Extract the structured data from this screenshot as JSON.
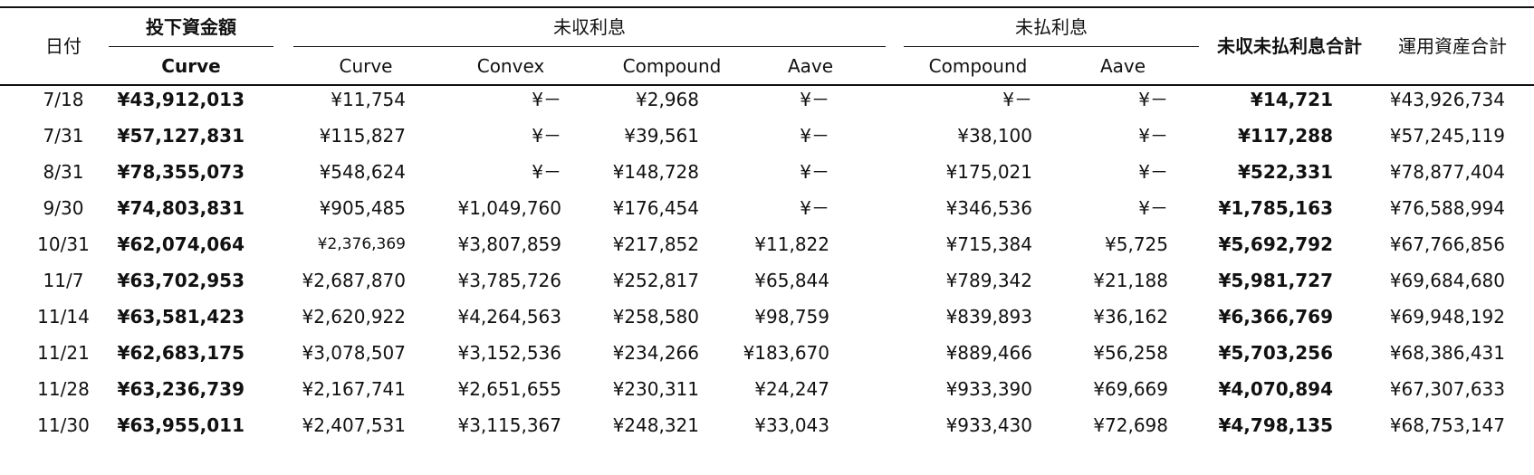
{
  "header": {
    "date": "日付",
    "investment": "投下資金額",
    "investment_sub": "Curve",
    "receivable": "未収利息",
    "receivable_cols": [
      "Curve",
      "Convex",
      "Compound",
      "Aave"
    ],
    "payable": "未払利息",
    "payable_cols": [
      "Compound",
      "Aave"
    ],
    "net_total": "未収未払利息合計",
    "asset_total": "運用資産合計"
  },
  "rows": [
    {
      "date": "7/18",
      "investment": "¥43,912,013",
      "rc_curve": "¥11,754",
      "rc_convex": "¥－",
      "rc_compound": "¥2,968",
      "rc_aave": "¥－",
      "pay_compound": "¥－",
      "pay_aave": "¥－",
      "net": "¥14,721",
      "total": "¥43,926,734"
    },
    {
      "date": "7/31",
      "investment": "¥57,127,831",
      "rc_curve": "¥115,827",
      "rc_convex": "¥－",
      "rc_compound": "¥39,561",
      "rc_aave": "¥－",
      "pay_compound": "¥38,100",
      "pay_aave": "¥－",
      "net": "¥117,288",
      "total": "¥57,245,119"
    },
    {
      "date": "8/31",
      "investment": "¥78,355,073",
      "rc_curve": "¥548,624",
      "rc_convex": "¥－",
      "rc_compound": "¥148,728",
      "rc_aave": "¥－",
      "pay_compound": "¥175,021",
      "pay_aave": "¥－",
      "net": "¥522,331",
      "total": "¥78,877,404"
    },
    {
      "date": "9/30",
      "investment": "¥74,803,831",
      "rc_curve": "¥905,485",
      "rc_convex": "¥1,049,760",
      "rc_compound": "¥176,454",
      "rc_aave": "¥－",
      "pay_compound": "¥346,536",
      "pay_aave": "¥－",
      "net": "¥1,785,163",
      "total": "¥76,588,994"
    },
    {
      "date": "10/31",
      "investment": "¥62,074,064",
      "rc_curve": "¥2,376,369",
      "rc_convex": "¥3,807,859",
      "rc_compound": "¥217,852",
      "rc_aave": "¥11,822",
      "pay_compound": "¥715,384",
      "pay_aave": "¥5,725",
      "net": "¥5,692,792",
      "total": "¥67,766,856"
    },
    {
      "date": "11/7",
      "investment": "¥63,702,953",
      "rc_curve": "¥2,687,870",
      "rc_convex": "¥3,785,726",
      "rc_compound": "¥252,817",
      "rc_aave": "¥65,844",
      "pay_compound": "¥789,342",
      "pay_aave": "¥21,188",
      "net": "¥5,981,727",
      "total": "¥69,684,680"
    },
    {
      "date": "11/14",
      "investment": "¥63,581,423",
      "rc_curve": "¥2,620,922",
      "rc_convex": "¥4,264,563",
      "rc_compound": "¥258,580",
      "rc_aave": "¥98,759",
      "pay_compound": "¥839,893",
      "pay_aave": "¥36,162",
      "net": "¥6,366,769",
      "total": "¥69,948,192"
    },
    {
      "date": "11/21",
      "investment": "¥62,683,175",
      "rc_curve": "¥3,078,507",
      "rc_convex": "¥3,152,536",
      "rc_compound": "¥234,266",
      "rc_aave": "¥183,670",
      "pay_compound": "¥889,466",
      "pay_aave": "¥56,258",
      "net": "¥5,703,256",
      "total": "¥68,386,431"
    },
    {
      "date": "11/28",
      "investment": "¥63,236,739",
      "rc_curve": "¥2,167,741",
      "rc_convex": "¥2,651,655",
      "rc_compound": "¥230,311",
      "rc_aave": "¥24,247",
      "pay_compound": "¥933,390",
      "pay_aave": "¥69,669",
      "net": "¥4,070,894",
      "total": "¥67,307,633"
    },
    {
      "date": "11/30",
      "investment": "¥63,955,011",
      "rc_curve": "¥2,407,531",
      "rc_convex": "¥3,115,367",
      "rc_compound": "¥248,321",
      "rc_aave": "¥33,043",
      "pay_compound": "¥933,430",
      "pay_aave": "¥72,698",
      "net": "¥4,798,135",
      "total": "¥68,753,147"
    }
  ]
}
